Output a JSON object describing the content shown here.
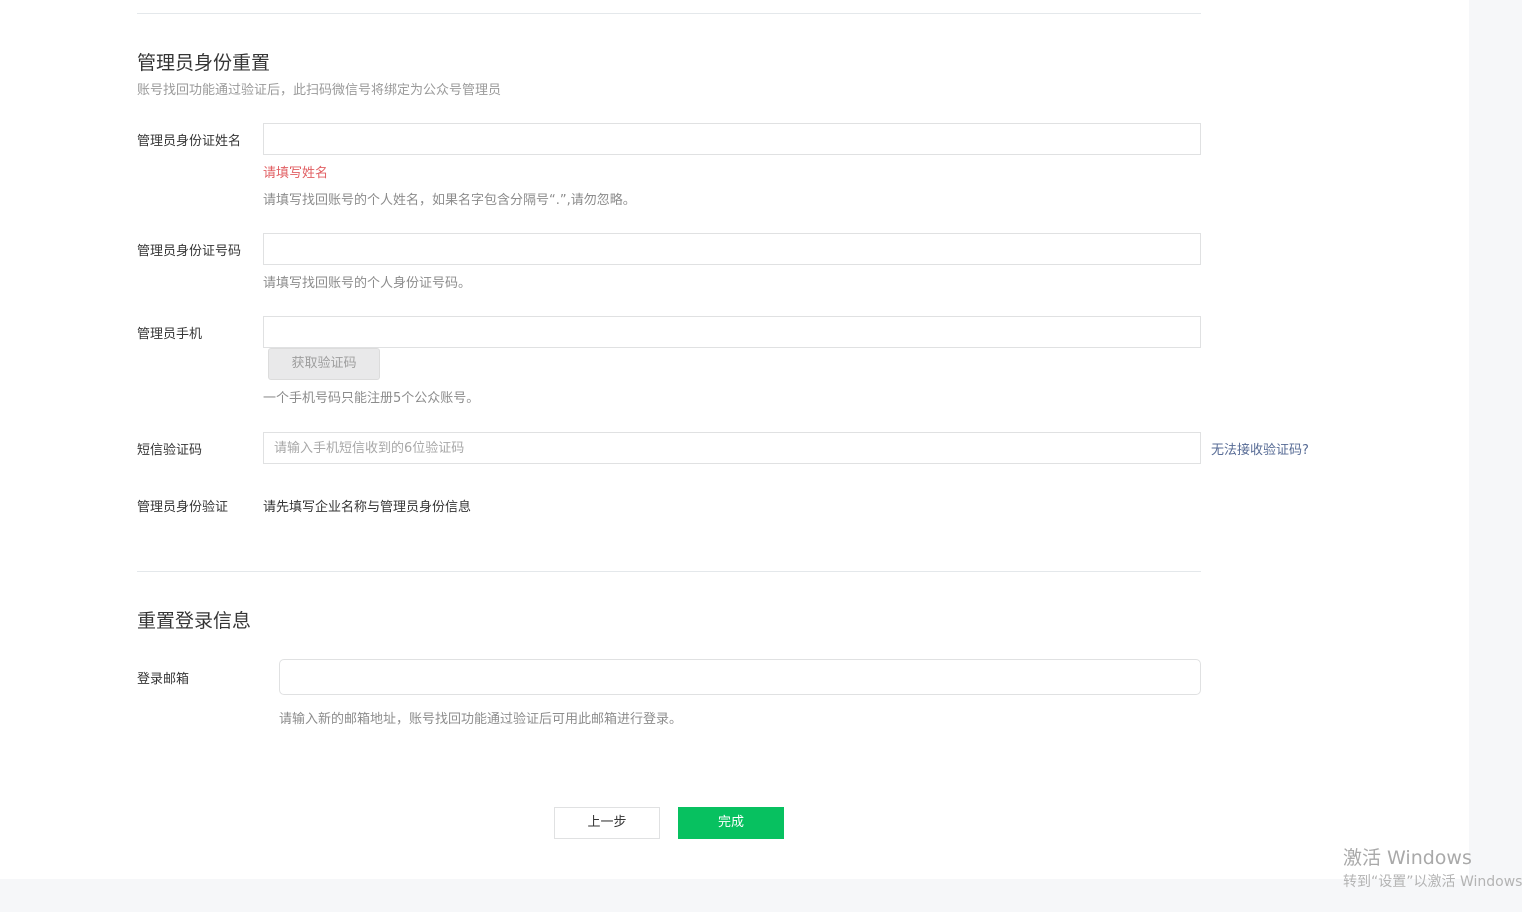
{
  "identity_section": {
    "title": "管理员身份重置",
    "description": "账号找回功能通过验证后，此扫码微信号将绑定为公众号管理员",
    "name_field": {
      "label": "管理员身份证姓名",
      "value": "",
      "error": "请填写姓名",
      "tip": "请填写找回账号的个人姓名，如果名字包含分隔号“.”,请勿忽略。"
    },
    "id_field": {
      "label": "管理员身份证号码",
      "value": "",
      "tip": "请填写找回账号的个人身份证号码。"
    },
    "phone_field": {
      "label": "管理员手机",
      "value": "",
      "code_button": "获取验证码",
      "tip": "一个手机号码只能注册5个公众账号。"
    },
    "sms_field": {
      "label": "短信验证码",
      "placeholder": "请输入手机短信收到的6位验证码",
      "help_link": "无法接收验证码?"
    },
    "verify_field": {
      "label": "管理员身份验证",
      "value": "请先填写企业名称与管理员身份信息"
    }
  },
  "login_section": {
    "title": "重置登录信息",
    "email_field": {
      "label": "登录邮箱",
      "value": "",
      "tip": "请输入新的邮箱地址，账号找回功能通过验证后可用此邮箱进行登录。"
    }
  },
  "actions": {
    "prev_label": "上一步",
    "done_label": "完成"
  },
  "watermark": {
    "title": "激活 Windows",
    "subtitle": "转到“设置”以激活 Windows"
  },
  "colors": {
    "primary": "#07c160",
    "error": "#e15f63",
    "link": "#576b95"
  }
}
